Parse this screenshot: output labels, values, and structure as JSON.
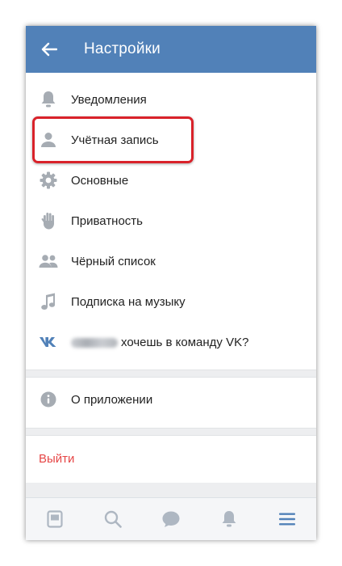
{
  "header": {
    "title": "Настройки",
    "back_icon": "arrow-left-icon"
  },
  "menu": {
    "items": [
      {
        "label": "Уведомления",
        "icon": "bell-icon"
      },
      {
        "label": "Учётная запись",
        "icon": "person-icon"
      },
      {
        "label": "Основные",
        "icon": "gear-icon"
      },
      {
        "label": "Приватность",
        "icon": "hand-icon"
      },
      {
        "label": "Чёрный список",
        "icon": "people-icon"
      },
      {
        "label": "Подписка на музыку",
        "icon": "music-note-icon"
      },
      {
        "label": "хочешь в команду VK?",
        "icon": "vk-logo-icon"
      }
    ],
    "about": {
      "label": "О приложении",
      "icon": "info-icon"
    },
    "logout": {
      "label": "Выйти"
    }
  },
  "tabbar": {
    "tabs": [
      "news-icon",
      "search-icon",
      "messages-icon",
      "notifications-icon",
      "menu-icon"
    ],
    "active_color": "#5181b8",
    "inactive_color": "#aeb7c2"
  },
  "colors": {
    "header_bg": "#5181b8",
    "highlight": "#d9222a",
    "logout": "#e64646"
  }
}
